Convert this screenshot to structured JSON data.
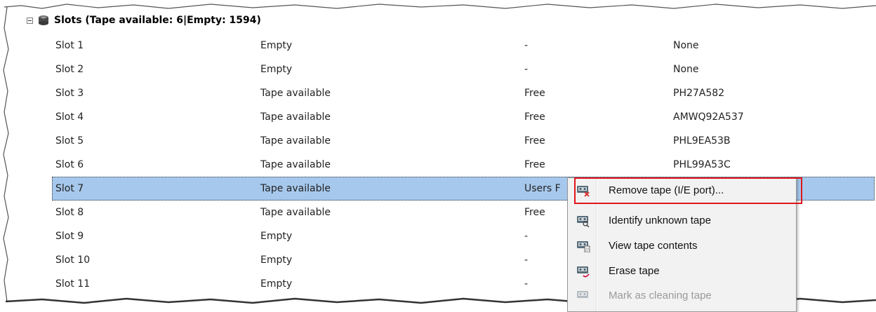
{
  "section": {
    "title": "Slots (Tape available: 6|Empty: 1594)"
  },
  "slots": [
    {
      "slot": "Slot 1",
      "status": "Empty",
      "pool": "-",
      "barcode": "None"
    },
    {
      "slot": "Slot 2",
      "status": "Empty",
      "pool": "-",
      "barcode": "None"
    },
    {
      "slot": "Slot 3",
      "status": "Tape available",
      "pool": "Free",
      "barcode": "PH27A582"
    },
    {
      "slot": "Slot 4",
      "status": "Tape available",
      "pool": "Free",
      "barcode": "AMWQ92A537"
    },
    {
      "slot": "Slot 5",
      "status": "Tape available",
      "pool": "Free",
      "barcode": "PHL9EA53B"
    },
    {
      "slot": "Slot 6",
      "status": "Tape available",
      "pool": "Free",
      "barcode": "PHL99A53C"
    },
    {
      "slot": "Slot 7",
      "status": "Tape available",
      "pool": "Users F",
      "barcode": ""
    },
    {
      "slot": "Slot 8",
      "status": "Tape available",
      "pool": "Free",
      "barcode": ""
    },
    {
      "slot": "Slot 9",
      "status": "Empty",
      "pool": "-",
      "barcode": ""
    },
    {
      "slot": "Slot 10",
      "status": "Empty",
      "pool": "-",
      "barcode": ""
    },
    {
      "slot": "Slot 11",
      "status": "Empty",
      "pool": "-",
      "barcode": ""
    }
  ],
  "selected_row": "Slot 7",
  "context_menu": {
    "items": [
      {
        "label": "Remove tape (I/E port)...",
        "icon": "tape-remove-icon",
        "enabled": true,
        "highlighted": true
      },
      {
        "label": "Identify unknown tape",
        "icon": "tape-identify-icon",
        "enabled": true
      },
      {
        "label": "View tape contents",
        "icon": "tape-view-icon",
        "enabled": true
      },
      {
        "label": "Erase tape",
        "icon": "tape-erase-icon",
        "enabled": true
      },
      {
        "label": "Mark as cleaning tape",
        "icon": "tape-cleaning-icon",
        "enabled": false
      }
    ]
  },
  "colors": {
    "selection": "#a6c8ec",
    "highlight_box": "#e0161b",
    "menu_background": "#f2f2f2"
  }
}
